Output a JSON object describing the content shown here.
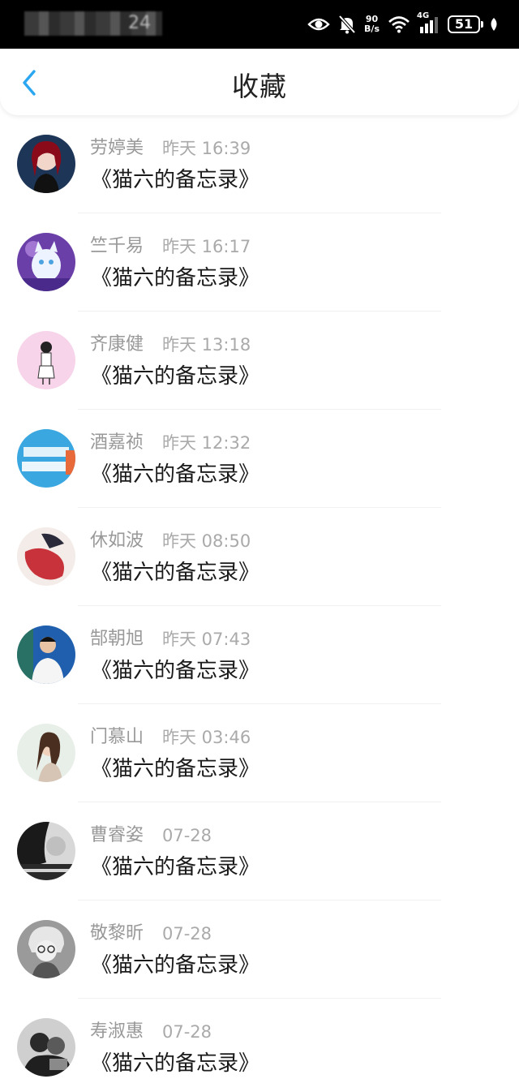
{
  "status_bar": {
    "time": "24",
    "net_speed_value": "90",
    "net_speed_unit": "B/s",
    "network_type": "4G",
    "battery": "51",
    "icons": [
      "eye-icon",
      "bell-off-icon",
      "wifi-icon",
      "signal-icon",
      "battery-icon",
      "leaf-icon"
    ]
  },
  "header": {
    "title": "收藏",
    "back_icon": "chevron-left-icon",
    "accent_color": "#2aa7f0"
  },
  "favorites": [
    {
      "name": "劳婷美",
      "time": "昨天 16:39",
      "title": "《猫六的备忘录》"
    },
    {
      "name": "竺千易",
      "time": "昨天 16:17",
      "title": "《猫六的备忘录》"
    },
    {
      "name": "齐康健",
      "time": "昨天 13:18",
      "title": "《猫六的备忘录》"
    },
    {
      "name": "酒嘉祯",
      "time": "昨天 12:32",
      "title": "《猫六的备忘录》"
    },
    {
      "name": "休如波",
      "time": "昨天 08:50",
      "title": "《猫六的备忘录》"
    },
    {
      "name": "郜朝旭",
      "time": "昨天 07:43",
      "title": "《猫六的备忘录》"
    },
    {
      "name": "门慕山",
      "time": "昨天 03:46",
      "title": "《猫六的备忘录》"
    },
    {
      "name": "曹睿姿",
      "time": "07-28",
      "title": "《猫六的备忘录》"
    },
    {
      "name": "敬黎昕",
      "time": "07-28",
      "title": "《猫六的备忘录》"
    },
    {
      "name": "寿淑惠",
      "time": "07-28",
      "title": "《猫六的备忘录》"
    }
  ]
}
